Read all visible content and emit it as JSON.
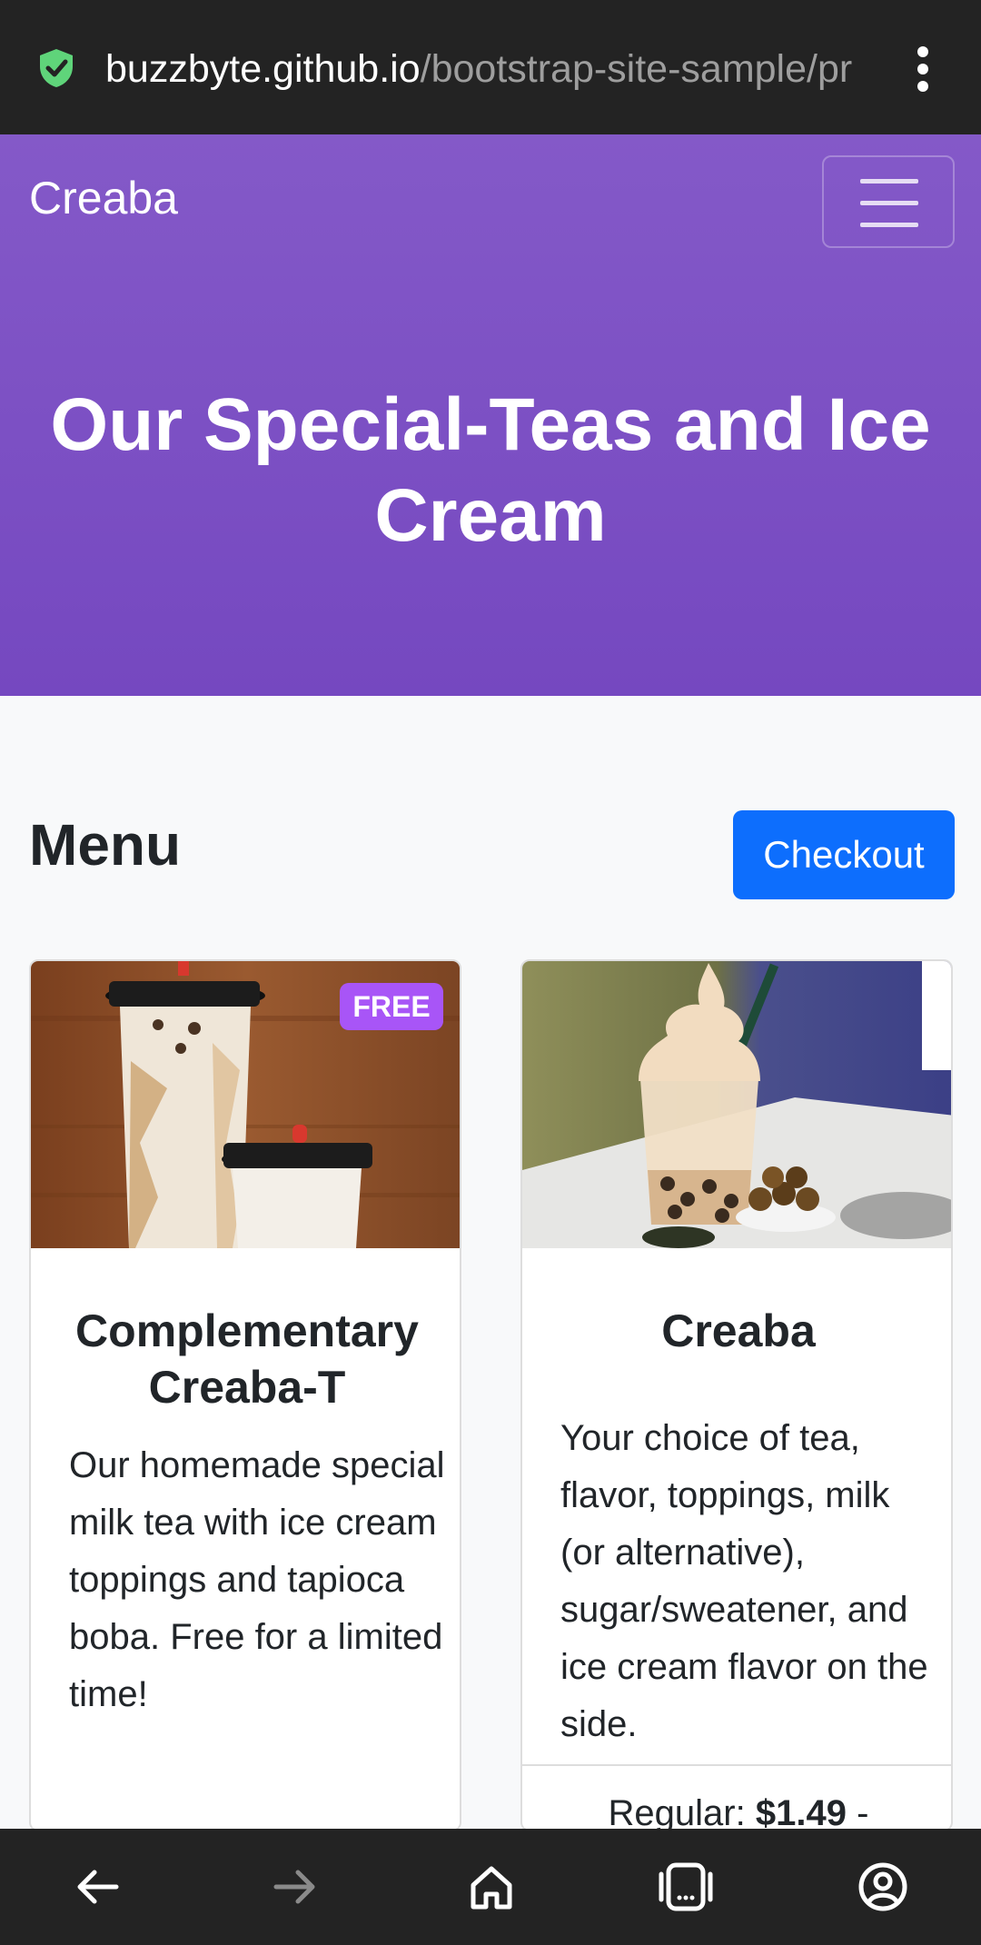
{
  "browser": {
    "url_host": "buzzbyte.github.io",
    "url_path": "/bootstrap-site-sample/pr",
    "icons": [
      "shield-check-icon",
      "more-vert-icon"
    ]
  },
  "navbar": {
    "brand": "Creaba",
    "toggler_icon": "hamburger-icon"
  },
  "hero": {
    "title": "Our Special-Teas and Ice Cream"
  },
  "menu": {
    "heading": "Menu",
    "checkout_label": "Checkout",
    "cards": [
      {
        "badge": "FREE",
        "title": "Complementary Creaba-T",
        "text": "Our homemade special milk tea with ice cream toppings and tapioca boba. Free for a limited time!"
      },
      {
        "title": "Creaba",
        "text": "Your choice of tea, flavor, toppings, milk (or alternative), sugar/sweatener, and ice cream flavor on the side.",
        "price_label": "Regular:",
        "price_value": "$1.49",
        "price_suffix": "-"
      }
    ]
  },
  "bottom_nav": {
    "icons": [
      "back-arrow-icon",
      "forward-arrow-icon",
      "home-icon",
      "tabs-icon",
      "account-icon"
    ]
  },
  "colors": {
    "hero_bg": "#7b4fc4",
    "checkout_bg": "#0d6efd",
    "badge_bg": "#a855f7",
    "browser_bar": "#232323"
  }
}
